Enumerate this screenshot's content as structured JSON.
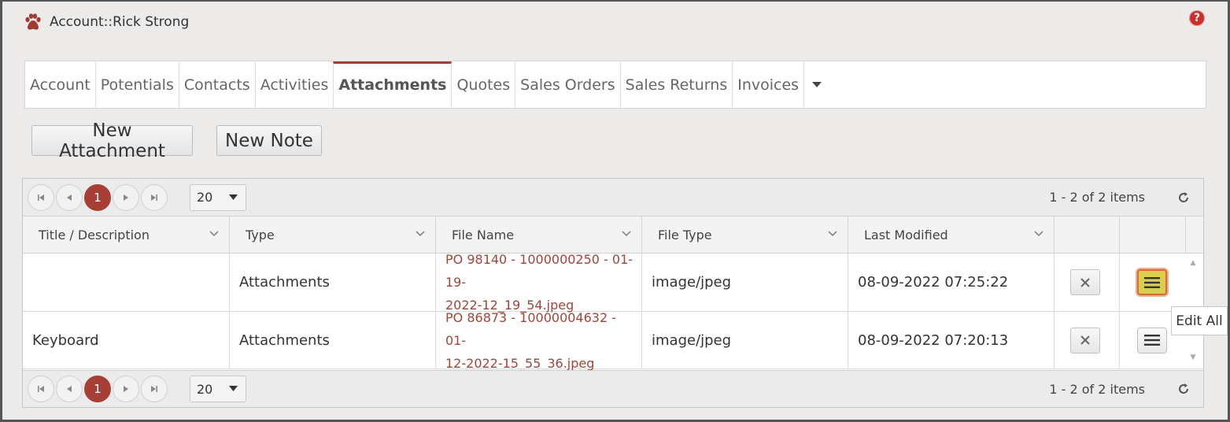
{
  "header": {
    "title": "Account::Rick Strong",
    "help_glyph": "?"
  },
  "tabs": [
    {
      "label": "Account"
    },
    {
      "label": "Potentials"
    },
    {
      "label": "Contacts"
    },
    {
      "label": "Activities"
    },
    {
      "label": "Attachments"
    },
    {
      "label": "Quotes"
    },
    {
      "label": "Sales Orders"
    },
    {
      "label": "Sales Returns"
    },
    {
      "label": "Invoices"
    }
  ],
  "tabs_active": "Attachments",
  "buttons": {
    "new_attachment": "New Attachment",
    "new_note": "New Note"
  },
  "pager": {
    "current_page": "1",
    "page_size": "20",
    "info": "1 - 2 of 2 items"
  },
  "columns": [
    {
      "label": "Title / Description"
    },
    {
      "label": "Type"
    },
    {
      "label": "File Name"
    },
    {
      "label": "File Type"
    },
    {
      "label": "Last Modified"
    }
  ],
  "rows": [
    {
      "title": "",
      "type": "Attachments",
      "file_name": "PO 98140 - 1000000250 - 01-19-2022-12_19_54.jpeg",
      "file_name_line1": "PO 98140 - 1000000250 - 01-19-",
      "file_name_line2": "2022-12_19_54.jpeg",
      "file_type": "image/jpeg",
      "last_modified": "08-09-2022 07:25:22"
    },
    {
      "title": "Keyboard",
      "type": "Attachments",
      "file_name": "PO 86873 - 10000004632 - 01-12-2022-15_55_36.jpeg",
      "file_name_line1": "PO 86873 - 10000004632 - 01-",
      "file_name_line2": "12-2022-15_55_36.jpeg",
      "file_type": "image/jpeg",
      "last_modified": "08-09-2022 07:20:13"
    }
  ],
  "tooltip": "Edit All",
  "icons": {
    "logo": "paw-icon",
    "help": "help-icon",
    "tab_more": "caret-down-icon",
    "pager": [
      "first-page-icon",
      "prev-page-icon",
      "next-page-icon",
      "last-page-icon"
    ],
    "refresh": "refresh-icon",
    "delete": "close-icon",
    "row_menu": "hamburger-icon"
  },
  "colors": {
    "accent": "#a73f36",
    "link": "#a0453a",
    "highlight": "#d9cf4a",
    "highlight_border": "#e0643a"
  }
}
